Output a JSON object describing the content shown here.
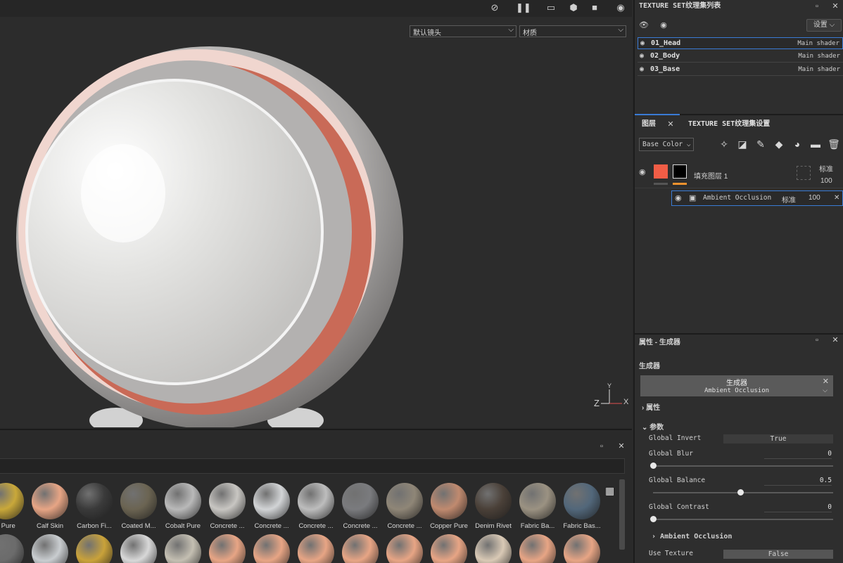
{
  "viewport": {
    "camera_select": "默认镜头",
    "channel_select": "材质",
    "axis": {
      "y": "Y",
      "z": "Z",
      "x": "X"
    },
    "icons": [
      "screenshot-off-icon",
      "pause-icon",
      "frame-icon",
      "cube-icon",
      "camera-icon",
      "photo-icon"
    ]
  },
  "texture_sets": {
    "title": "TEXTURE SET纹理集列表",
    "settings_label": "设置",
    "rows": [
      {
        "name": "01_Head",
        "shader": "Main shader"
      },
      {
        "name": "02_Body",
        "shader": "Main shader"
      },
      {
        "name": "03_Base",
        "shader": "Main shader"
      }
    ]
  },
  "layers": {
    "tab_layers": "图层",
    "tab_settings": "TEXTURE SET纹理集设置",
    "channel_select": "Base Color",
    "fill_layer": {
      "name": "填充图层 1",
      "blend": "标准",
      "opacity": "100"
    },
    "effect": {
      "name": "Ambient Occlusion",
      "blend": "标准",
      "opacity": "100"
    }
  },
  "properties": {
    "title": "属性 - 生成器",
    "section": "生成器",
    "generator_label": "生成器",
    "generator_name": "Ambient Occlusion",
    "group_attributes": "属性",
    "group_params": "参数",
    "global_invert_label": "Global Invert",
    "global_invert_value": "True",
    "global_blur_label": "Global Blur",
    "global_blur_value": "0",
    "global_balance_label": "Global Balance",
    "global_balance_value": "0.5",
    "global_contrast_label": "Global Contrast",
    "global_contrast_value": "0",
    "ao_group": "Ambient Occlusion",
    "use_texture_label": "Use Texture",
    "use_texture_value": "False",
    "slider_levels": {
      "blur": 0.0,
      "balance": 0.5,
      "contrast": 0.0
    }
  },
  "shelf": {
    "materials_row1": [
      "s Pure",
      "Calf Skin",
      "Carbon Fi...",
      "Coated M...",
      "Cobalt Pure",
      "Concrete ...",
      "Concrete ...",
      "Concrete ...",
      "Concrete ...",
      "Concrete ...",
      "Copper Pure",
      "Denim Rivet",
      "Fabric Ba...",
      "Fabric Bas..."
    ],
    "colors_row1": [
      "#c9a83a",
      "#e7a585",
      "#3a3a3a",
      "#6b6452",
      "#b9b9b9",
      "#c8c6c2",
      "#d2d4d6",
      "#bdbdbd",
      "#7a7b7e",
      "#8f8677",
      "#c08a6f",
      "#4a4038",
      "#9b9282",
      "#52677a"
    ],
    "colors_row2": [
      "#6b6b6b",
      "#c9cdd0",
      "#c9a23a",
      "#d8d8d8",
      "#c4bfb2",
      "#e7a585",
      "#e7a585",
      "#e7a585",
      "#e7a585",
      "#e7a585",
      "#e7a585",
      "#d9c9b5",
      "#e7a585",
      "#e7a585"
    ]
  }
}
